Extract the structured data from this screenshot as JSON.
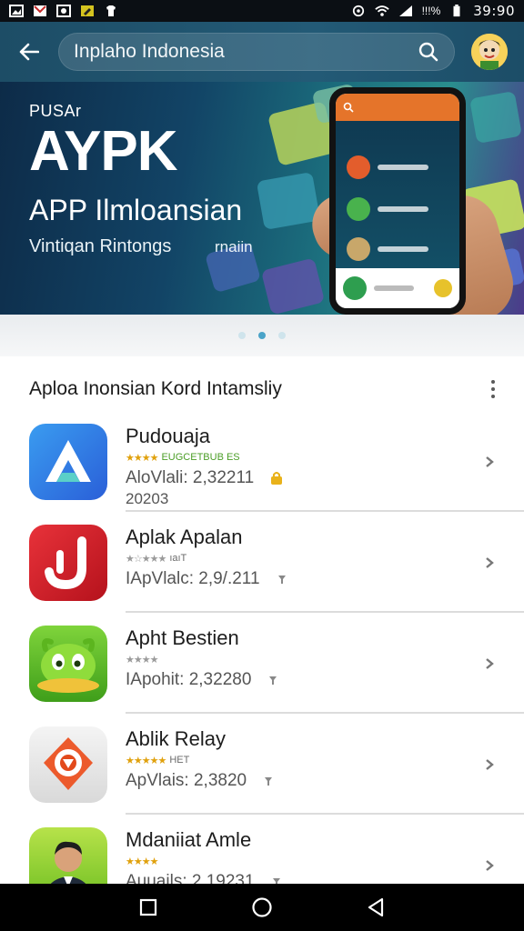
{
  "status_bar": {
    "battery_text": "!!!%",
    "time": "39:90"
  },
  "app_bar": {
    "search_text": "Inplaho Indonesia"
  },
  "banner": {
    "kicker": "PUSAr",
    "title": "AYPK",
    "subtitle": "APP Ilmloansian",
    "tagline": "Vintiqan Rintongs",
    "tagline_extra": "rnaiin"
  },
  "carousel": {
    "page_count": 3,
    "active_index": 1
  },
  "section": {
    "title": "Aploa Inonsian Kord Intamsliy"
  },
  "apps": [
    {
      "name": "Pudouaja",
      "stars": "★★★★",
      "rating_text": "EUGCETBUB ES",
      "rating_color": "#4b9e27",
      "meta": "AloVlali:  2,32211",
      "year": "20203",
      "icon": "delta-icon",
      "accent": "#1e7fe0"
    },
    {
      "name": "Aplak Apalan",
      "stars": "★☆★★★",
      "rating_text": "ıaıT",
      "rating_color": "#6b6b6b",
      "meta": "IApVlalc:  2,9/.211",
      "year": "",
      "icon": "j-icon",
      "accent": "#d7242c"
    },
    {
      "name": "Apht Bestien",
      "stars": "★★★★",
      "rating_text": "",
      "rating_color": "#6b6b6b",
      "meta": "IApohit:  2,32280",
      "year": "",
      "icon": "alien-icon",
      "accent": "#5fbf26"
    },
    {
      "name": "Ablik Relay",
      "stars": "★★★★★",
      "rating_text": "HET",
      "rating_color": "#6b6b6b",
      "meta": "ApVlais:  2,3820",
      "year": "",
      "icon": "relay-icon",
      "accent": "#e8522b"
    },
    {
      "name": "Mdaniiat Amle",
      "stars": "★★★★",
      "rating_text": "",
      "rating_color": "#6b6b6b",
      "meta": "Auuails:  2,19231",
      "year": "",
      "icon": "portrait-icon",
      "accent": "#7cc42a"
    }
  ],
  "colors": {
    "app_bar": "#1f5670",
    "nav_bar": "#000000",
    "star": "#e0a10d"
  }
}
